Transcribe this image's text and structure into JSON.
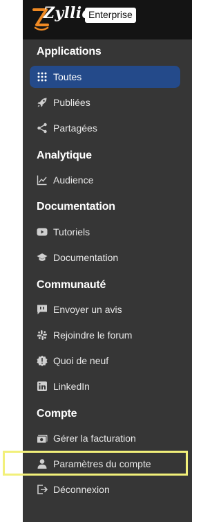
{
  "header": {
    "logo_text": "Zyllio",
    "badge": "Enterprise"
  },
  "sections": {
    "applications": {
      "title": "Applications",
      "items": [
        {
          "label": "Toutes",
          "icon": "grid-dots-icon"
        },
        {
          "label": "Publiées",
          "icon": "rocket-icon"
        },
        {
          "label": "Partagées",
          "icon": "share-icon"
        }
      ]
    },
    "analytique": {
      "title": "Analytique",
      "items": [
        {
          "label": "Audience",
          "icon": "line-chart-icon"
        }
      ]
    },
    "documentation": {
      "title": "Documentation",
      "items": [
        {
          "label": "Tutoriels",
          "icon": "youtube-icon"
        },
        {
          "label": "Documentation",
          "icon": "graduation-cap-icon"
        }
      ]
    },
    "communaute": {
      "title": "Communauté",
      "items": [
        {
          "label": "Envoyer un avis",
          "icon": "feedback-icon"
        },
        {
          "label": "Rejoindre le forum",
          "icon": "slack-icon"
        },
        {
          "label": "Quoi de neuf",
          "icon": "badge-alert-icon"
        },
        {
          "label": "LinkedIn",
          "icon": "linkedin-icon"
        }
      ]
    },
    "compte": {
      "title": "Compte",
      "items": [
        {
          "label": "Gérer la facturation",
          "icon": "billing-icon"
        },
        {
          "label": "Paramètres du compte",
          "icon": "user-icon"
        },
        {
          "label": "Déconnexion",
          "icon": "logout-icon"
        }
      ]
    }
  },
  "colors": {
    "sidebar_bg": "#363636",
    "topbar_bg": "#141414",
    "active_bg": "#244a8a",
    "highlight": "#f2f07a",
    "logo_accent": "#f08a24"
  }
}
